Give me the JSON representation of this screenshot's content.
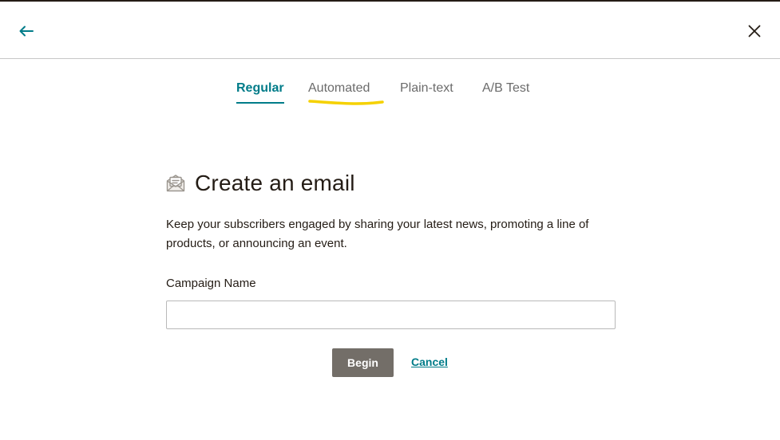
{
  "header": {
    "back_icon": "arrow-left-icon",
    "close_icon": "close-icon"
  },
  "tabs": [
    {
      "label": "Regular",
      "active": true
    },
    {
      "label": "Automated",
      "active": false
    },
    {
      "label": "Plain-text",
      "active": false
    },
    {
      "label": "A/B Test",
      "active": false
    }
  ],
  "main": {
    "icon": "email-envelope-icon",
    "title": "Create an email",
    "description": "Keep your subscribers engaged by sharing your latest news, promoting a line of products, or announcing an event.",
    "field_label": "Campaign Name",
    "field_value": "",
    "field_placeholder": "",
    "begin_label": "Begin",
    "cancel_label": "Cancel"
  },
  "colors": {
    "accent": "#007c89",
    "button_bg": "#736e68",
    "highlight": "#f5d100",
    "text": "#241c15"
  }
}
